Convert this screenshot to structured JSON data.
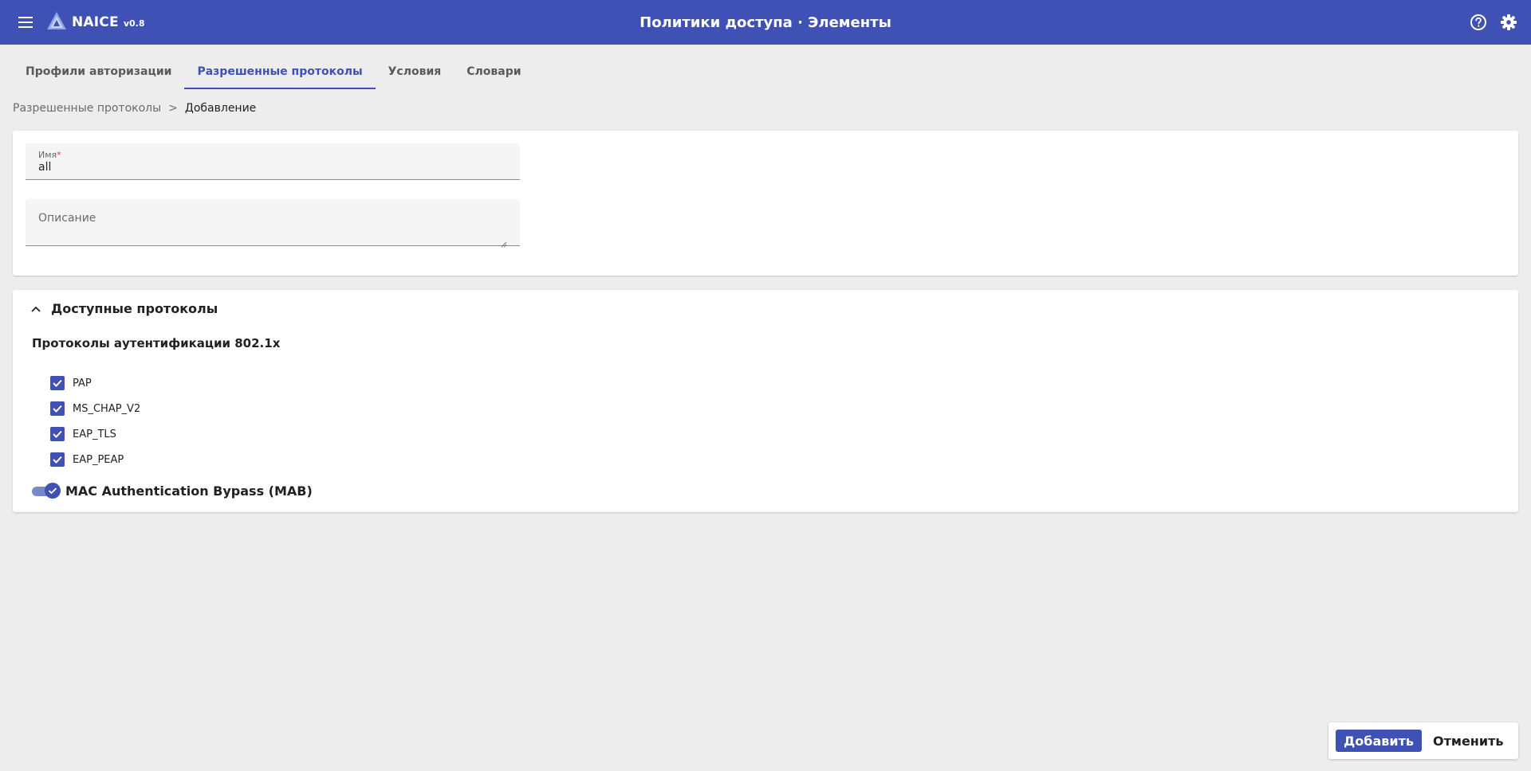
{
  "app": {
    "name": "NAICE",
    "version": "v0.8",
    "page_title": "Политики доступа · Элементы"
  },
  "icons": {
    "menu": "menu-icon",
    "logo": "naice-logo-icon",
    "help": "help-circle-icon",
    "settings": "gear-icon"
  },
  "tabs": [
    {
      "label": "Профили авторизации",
      "active": false
    },
    {
      "label": "Разрешенные протоколы",
      "active": true
    },
    {
      "label": "Условия",
      "active": false
    },
    {
      "label": "Словари",
      "active": false
    }
  ],
  "breadcrumb": {
    "parent": "Разрешенные протоколы",
    "separator": ">",
    "current": "Добавление"
  },
  "form": {
    "name_label": "Имя",
    "required_mark": "*",
    "name_value": "all",
    "description_placeholder": "Описание"
  },
  "protocols": {
    "section_title": "Доступные протоколы",
    "expanded": true,
    "group_title": "Протоколы аутентификации 802.1x",
    "items": [
      {
        "label": "PAP",
        "checked": true
      },
      {
        "label": "MS_CHAP_V2",
        "checked": true
      },
      {
        "label": "EAP_TLS",
        "checked": true
      },
      {
        "label": "EAP_PEAP",
        "checked": true
      }
    ],
    "mab": {
      "label": "MAC Authentication Bypass (MAB)",
      "enabled": true
    }
  },
  "footer": {
    "add_label": "Добавить",
    "cancel_label": "Отменить"
  },
  "colors": {
    "primary": "#3f51b5",
    "background": "#ededed",
    "required": "#e53935"
  }
}
